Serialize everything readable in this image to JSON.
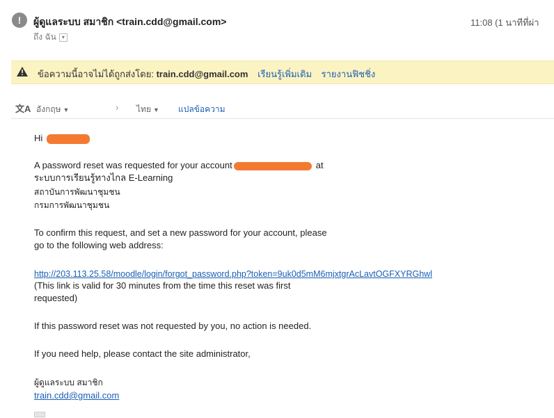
{
  "header": {
    "avatar_symbol": "!",
    "sender": "ผู้ดูแลระบบ สมาชิก <train.cdd@gmail.com>",
    "to_label": "ถึง ฉัน",
    "to_caret": "▾",
    "time": "11:08 (1 นาทีที่ผ่า"
  },
  "warning": {
    "icon": "warning-triangle-icon",
    "text": "ข้อความนี้อาจไม่ได้ถูกส่งโดย:",
    "sender": "train.cdd@gmail.com",
    "learn_more": "เรียนรู้เพิ่มเติม",
    "report": "รายงานฟิชชิ่ง"
  },
  "translate": {
    "icon": "translate-icon",
    "icon_text": "文A",
    "from_lang": "อังกฤษ",
    "arrow": "›",
    "to_lang": "ไทย",
    "action": "แปลข้อความ"
  },
  "body": {
    "greeting": "Hi",
    "line1_pre": "A password reset was requested for your account",
    "line1_post": "at",
    "line2": "ระบบการเรียนรู้ทางไกล E-Learning",
    "line3": "สถาบันการพัฒนาชุมชน",
    "line4": "กรมการพัฒนาชุมชน",
    "confirm1": "To confirm this request, and set a new password for your account, please",
    "confirm2": "go to the following web address:",
    "reset_link": "http://203.113.25.58/moodle/login/forgot_password.php?token=9uk0d5mM6mjxtgrAcLavtOGFXYRGhwl",
    "valid1": "(This link is valid for 30 minutes from the time this reset was first",
    "valid2": "requested)",
    "not_requested": "If this password reset was not requested by you, no action is needed.",
    "help": "If you need help, please contact the site administrator,",
    "signature_name": "ผู้ดูแลระบบ สมาชิก",
    "signature_email": "train.cdd@gmail.com"
  },
  "colors": {
    "warning_bg": "#fcf3c3",
    "link": "#1a5fb4",
    "redaction": "#f47a32"
  }
}
